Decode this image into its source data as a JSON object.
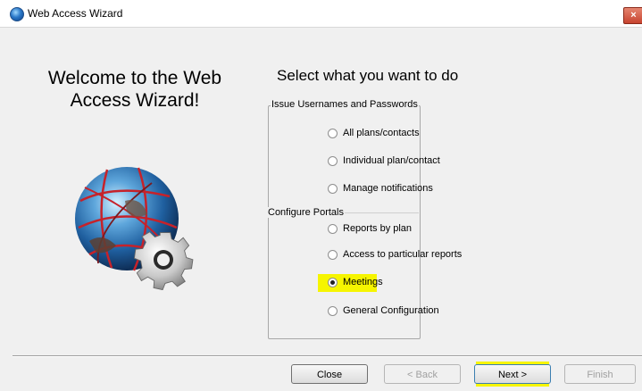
{
  "window": {
    "title": "Web Access Wizard",
    "close_label": "×"
  },
  "welcome": {
    "line1": "Welcome to the Web",
    "line2": "Access Wizard!"
  },
  "main": {
    "heading": "Select what you want to do",
    "groups": [
      {
        "label": "Issue Usernames and Passwords",
        "options": [
          "All plans/contacts",
          "Individual plan/contact",
          "Manage notifications"
        ]
      },
      {
        "label": "Configure Portals",
        "options": [
          "Reports by plan",
          "Access to particular reports",
          "Meetings",
          "General Configuration"
        ]
      }
    ],
    "selected_option": "Meetings"
  },
  "buttons": {
    "close": "Close",
    "back": "< Back",
    "next": "Next >",
    "finish": "Finish"
  },
  "colors": {
    "highlight": "#f6f500",
    "window_bg": "#f0f0f0"
  }
}
